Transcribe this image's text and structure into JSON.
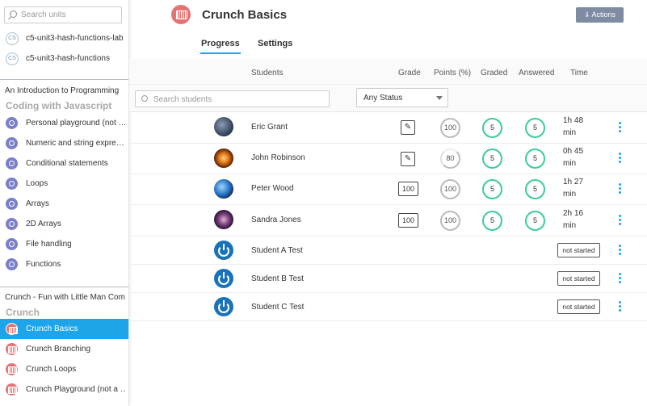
{
  "sidebar": {
    "search_placeholder": "Search units",
    "units": [
      {
        "badge": "CS",
        "label": "c5-unit3-hash-functions-lab"
      },
      {
        "badge": "CS",
        "label": "c5-unit3-hash-functions"
      }
    ],
    "section1": {
      "title": "An Introduction to Programming",
      "subtitle": "Coding with Javascript",
      "lessons": [
        "Personal playground (not …",
        "Numeric and string expre…",
        "Conditional statements",
        "Loops",
        "Arrays",
        "2D Arrays",
        "File handling",
        "Functions"
      ]
    },
    "section2": {
      "title": "Crunch - Fun with Little Man Com",
      "subtitle": "Crunch",
      "items": [
        {
          "label": "Crunch Basics",
          "active": true
        },
        {
          "label": "Crunch Branching",
          "active": false
        },
        {
          "label": "Crunch Loops",
          "active": false
        },
        {
          "label": "Crunch Playground (not a …",
          "active": false
        }
      ]
    }
  },
  "header": {
    "title": "Crunch Basics",
    "actions_label": "⇓ Actions",
    "tabs": [
      {
        "label": "Progress",
        "active": true
      },
      {
        "label": "Settings",
        "active": false
      }
    ]
  },
  "table": {
    "headers": {
      "students": "Students",
      "grade": "Grade",
      "points": "Points (%)",
      "graded": "Graded",
      "answered": "Answered",
      "time": "Time"
    },
    "search_placeholder": "Search students",
    "status_filter": "Any Status",
    "rows": [
      {
        "name": "Eric Grant",
        "grade": "",
        "points": "100",
        "graded": "5",
        "answered": "5",
        "time_h": "1h 48",
        "time_m": "min"
      },
      {
        "name": "John Robinson",
        "grade": "",
        "points": "80",
        "graded": "5",
        "answered": "5",
        "time_h": "0h 45",
        "time_m": "min"
      },
      {
        "name": "Peter Wood",
        "grade": "100",
        "points": "100",
        "graded": "5",
        "answered": "5",
        "time_h": "1h 27",
        "time_m": "min"
      },
      {
        "name": "Sandra Jones",
        "grade": "100",
        "points": "100",
        "graded": "5",
        "answered": "5",
        "time_h": "2h 16",
        "time_m": "min"
      },
      {
        "name": "Student A Test",
        "status": "not started"
      },
      {
        "name": "Student B Test",
        "status": "not started"
      },
      {
        "name": "Student C Test",
        "status": "not started"
      }
    ]
  },
  "colors": {
    "accent": "#1ea4e9",
    "ring": "#3ccc9a",
    "crunch_icon": "#e57373",
    "lesson_icon": "#7a7fc9",
    "actions_bg": "#7e8ba3"
  }
}
